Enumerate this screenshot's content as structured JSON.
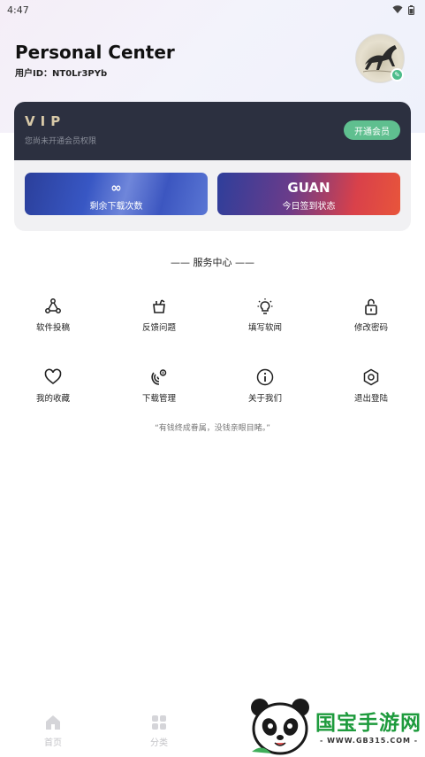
{
  "status_bar": {
    "time": "4:47"
  },
  "header": {
    "title": "Personal Center",
    "user_id": "用户ID：NT0Lr3PYb"
  },
  "vip": {
    "title": "VIP",
    "subtitle": "您尚未开通会员权限",
    "button_label": "开通会员"
  },
  "stats": [
    {
      "value": "∞",
      "label": "剩余下载次数"
    },
    {
      "value": "GUAN",
      "label": "今日签到状态"
    }
  ],
  "services": {
    "title": "—— 服务中心 ——",
    "items": [
      {
        "label": "软件投稿",
        "icon": "share-icon"
      },
      {
        "label": "反馈问题",
        "icon": "feedback-icon"
      },
      {
        "label": "填写软闻",
        "icon": "lightbulb-icon"
      },
      {
        "label": "修改密码",
        "icon": "lock-icon"
      },
      {
        "label": "我的收藏",
        "icon": "heart-icon"
      },
      {
        "label": "下载管理",
        "icon": "download-manage-icon"
      },
      {
        "label": "关于我们",
        "icon": "info-icon"
      },
      {
        "label": "退出登陆",
        "icon": "logout-icon"
      }
    ],
    "quote": "“有钱终成眷属，没钱亲眼目睹。”"
  },
  "tabs": [
    {
      "label": "首页",
      "icon": "home-icon"
    },
    {
      "label": "分类",
      "icon": "grid-icon"
    }
  ],
  "watermark": {
    "text": "国宝手游网",
    "url": "- WWW.GB315.COM -"
  },
  "colors": {
    "vip_bg": "#2c3040",
    "vip_button": "#5fbf8f",
    "vip_title": "#d8c9a8",
    "watermark_green": "#1e9b3d"
  }
}
